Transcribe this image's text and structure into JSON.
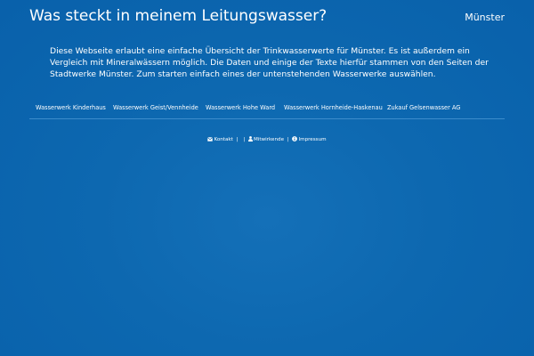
{
  "header": {
    "title": "Was steckt in meinem Leitungswasser?",
    "city": "Münster"
  },
  "intro": {
    "text": "Diese Webseite erlaubt eine einfache Übersicht der Trinkwasserwerte für Münster. Es ist außerdem ein Vergleich mit Mineralwässern möglich. Die Daten und einige der Texte hierfür stammen von den Seiten der Stadtwerke Münster. Zum starten einfach eines der untenstehenden Wasserwerke auswählen."
  },
  "nav": {
    "items": [
      {
        "label": "Wasserwerk Kinderhaus"
      },
      {
        "label": "Wasserwerk Geist/Vennheide"
      },
      {
        "label": "Wasserwerk Hohe Ward"
      },
      {
        "label": "Wasserwerk Hornheide-Haskenau"
      },
      {
        "label": "Zukauf Gelsenwasser AG"
      }
    ]
  },
  "footer": {
    "contact_label": "Kontakt",
    "separator": "|",
    "contributors_label": "Mitwirkende",
    "imprint_label": "Impressum",
    "icons": {
      "contact": "envelope-icon",
      "contributors": "user-icon",
      "imprint": "info-circle-icon"
    }
  },
  "colors": {
    "background": "#0d68b0",
    "text": "#ffffff",
    "divider": "#3c8ccc"
  }
}
